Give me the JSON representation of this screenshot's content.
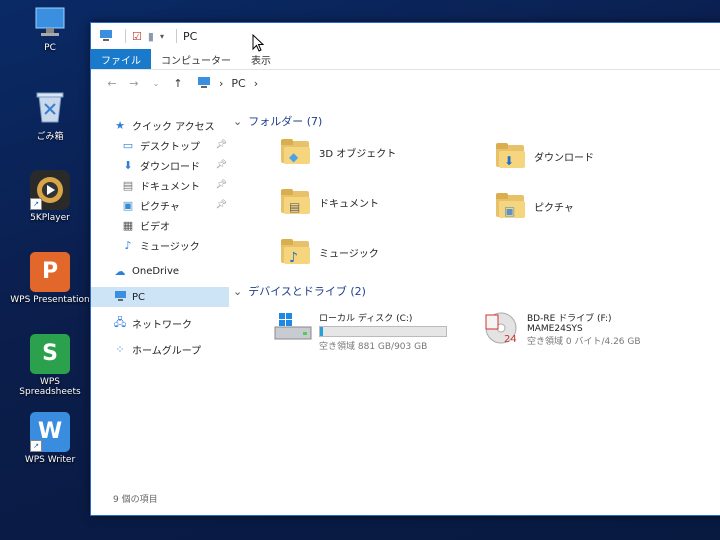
{
  "desktop": {
    "icons": [
      {
        "label": "PC",
        "icon": "pc-icon"
      },
      {
        "label": "ごみ箱",
        "icon": "recycle-bin-icon"
      },
      {
        "label": "5KPlayer",
        "icon": "5kplayer-icon"
      },
      {
        "label": "WPS Presentation",
        "icon": "wps-presentation-icon",
        "glyph": "P",
        "color": "#e2672b"
      },
      {
        "label": "WPS Spreadsheets",
        "icon": "wps-spreadsheets-icon",
        "glyph": "S",
        "color": "#2ba14d"
      },
      {
        "label": "WPS Writer",
        "icon": "wps-writer-icon",
        "glyph": "W",
        "color": "#3a8dde"
      }
    ]
  },
  "window": {
    "title": "PC",
    "tabs": [
      "ファイル",
      "コンピューター",
      "表示"
    ],
    "address": {
      "location": "PC"
    }
  },
  "nav_pane": {
    "quick_access": "クイック アクセス",
    "quick_items": [
      {
        "label": "デスクトップ",
        "icon": "desktop-folder-icon",
        "glyph": "▭",
        "pinned": true
      },
      {
        "label": "ダウンロード",
        "icon": "download-arrow-icon",
        "glyph": "⬇",
        "pinned": true
      },
      {
        "label": "ドキュメント",
        "icon": "document-icon",
        "glyph": "▤",
        "pinned": true
      },
      {
        "label": "ピクチャ",
        "icon": "pictures-icon",
        "glyph": "▣",
        "pinned": true
      },
      {
        "label": "ビデオ",
        "icon": "video-icon",
        "glyph": "▦",
        "pinned": false
      },
      {
        "label": "ミュージック",
        "icon": "music-note-icon",
        "glyph": "♪",
        "pinned": false
      }
    ],
    "onedrive": "OneDrive",
    "pc": "PC",
    "network": "ネットワーク",
    "homegroup": "ホームグループ"
  },
  "content": {
    "folders_header": "フォルダー (7)",
    "folders": [
      {
        "label": "3D オブジェクト",
        "icon": "3d-objects-folder-icon",
        "overlay": "◆"
      },
      {
        "label": "ダウンロード",
        "icon": "downloads-folder-icon",
        "overlay": "⬇"
      },
      {
        "label": "ドキュメント",
        "icon": "documents-folder-icon",
        "overlay": "▤"
      },
      {
        "label": "ピクチャ",
        "icon": "pictures-folder-icon",
        "overlay": "▣"
      },
      {
        "label": "ミュージック",
        "icon": "music-folder-icon",
        "overlay": "♪"
      }
    ],
    "devices_header": "デバイスとドライブ (2)",
    "drives": [
      {
        "name": "ローカル ディスク (C:)",
        "free": "空き領域 881 GB/903 GB",
        "used_fraction": 0.024,
        "icon": "local-disk-icon"
      },
      {
        "name": "BD-RE ドライブ (F:)",
        "label2": "MAME24SYS",
        "free": "空き領域 0 バイト/4.26 GB",
        "icon": "optical-disc-icon"
      }
    ]
  },
  "status": {
    "item_count": "9 個の項目"
  }
}
